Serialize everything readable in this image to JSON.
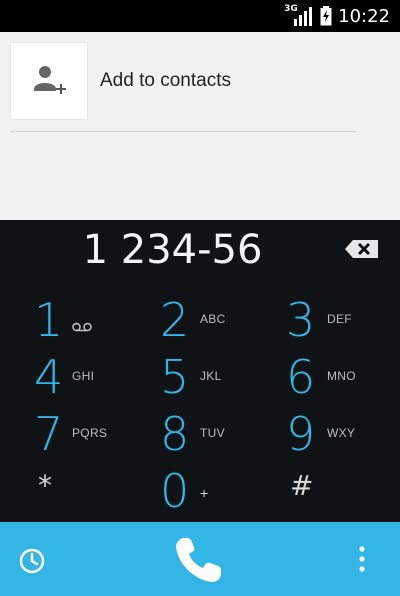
{
  "status_bar": {
    "network_label": "3G",
    "time": "10:22",
    "icons": [
      "signal-icon",
      "battery-icon"
    ]
  },
  "add_contact": {
    "label": "Add to contacts",
    "icon": "add-contact-icon"
  },
  "dialer": {
    "number": "1 234-56",
    "backspace_icon": "backspace-icon",
    "keys": [
      {
        "digit": "1",
        "letters": "",
        "extra_icon": "voicemail-icon"
      },
      {
        "digit": "2",
        "letters": "ABC"
      },
      {
        "digit": "3",
        "letters": "DEF"
      },
      {
        "digit": "4",
        "letters": "GHI"
      },
      {
        "digit": "5",
        "letters": "JKL"
      },
      {
        "digit": "6",
        "letters": "MNO"
      },
      {
        "digit": "7",
        "letters": "PQRS"
      },
      {
        "digit": "8",
        "letters": "TUV"
      },
      {
        "digit": "9",
        "letters": "WXY"
      },
      {
        "digit": "*",
        "letters": ""
      },
      {
        "digit": "0",
        "letters": "+"
      },
      {
        "digit": "#",
        "letters": ""
      }
    ]
  },
  "bottom_bar": {
    "icons": [
      "history-icon",
      "phone-call-icon",
      "overflow-menu-icon"
    ]
  },
  "colors": {
    "accent": "#33b5e5",
    "dialpad_bg": "#101316",
    "top_bg": "#f2f2f2"
  }
}
